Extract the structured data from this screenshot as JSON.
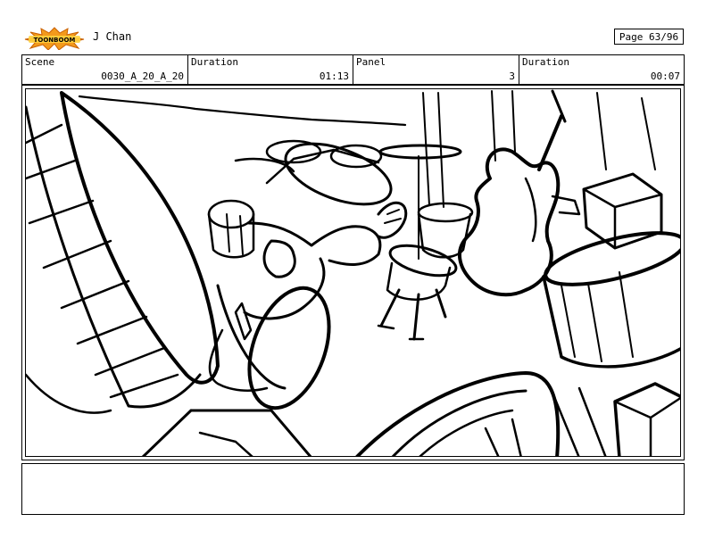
{
  "header": {
    "logo_text": "TOONBOOM",
    "author": "J Chan",
    "page": "Page 63/96"
  },
  "info": {
    "scene_label": "Scene",
    "scene_value": "0030_A_20_A_20",
    "duration1_label": "Duration",
    "duration1_value": "01:13",
    "panel_label": "Panel",
    "panel_value": "3",
    "duration2_label": "Duration",
    "duration2_value": "00:07"
  },
  "notes": {
    "text": ""
  }
}
